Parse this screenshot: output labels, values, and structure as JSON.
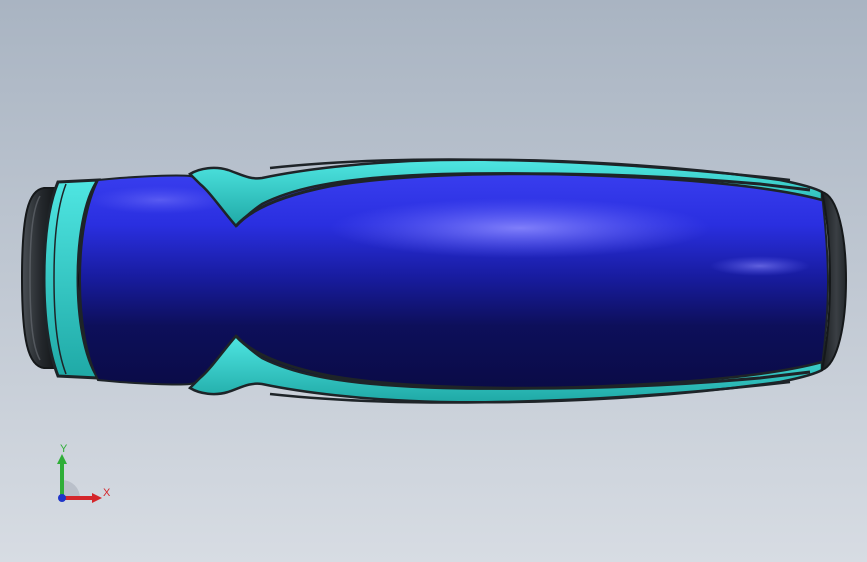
{
  "viewport": {
    "background_top": "#a9b4c2",
    "background_bottom": "#d7dce3"
  },
  "model": {
    "handle_color": "#2a2fd8",
    "handle_shadow_color": "#0b0c4a",
    "accent_color": "#2fd3d0",
    "outline_color": "#1e2428",
    "end_cap_color": "#2b2f33"
  },
  "triad": {
    "x_label": "X",
    "y_label": "Y",
    "x_color": "#d4262b",
    "y_color": "#2fae38",
    "z_color": "#1f35c9"
  }
}
